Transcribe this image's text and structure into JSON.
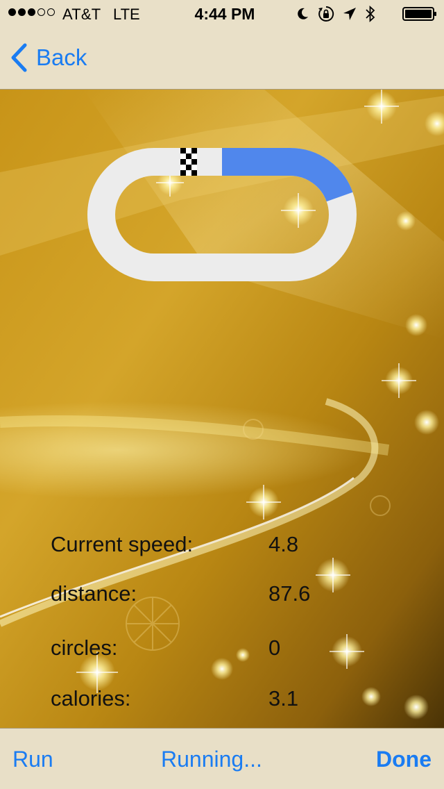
{
  "status_bar": {
    "carrier": "AT&T",
    "network": "LTE",
    "time": "4:44 PM",
    "signal_bars_filled": 3,
    "signal_bars_total": 5,
    "icons": [
      "moon-icon",
      "rotation-lock-icon",
      "location-icon",
      "bluetooth-icon",
      "battery-icon"
    ]
  },
  "nav": {
    "back_label": "Back"
  },
  "track": {
    "progress_fraction": 0.22,
    "start_marker": "checkered-flag",
    "progress_color": "#5087ec",
    "track_color": "#ececec"
  },
  "stats": [
    {
      "label": "Current speed:",
      "value": "4.8"
    },
    {
      "label": "distance:",
      "value": "87.6"
    },
    {
      "label": "circles:",
      "value": "0"
    },
    {
      "label": "calories:",
      "value": "3.1"
    }
  ],
  "toolbar": {
    "run_label": "Run",
    "running_label": "Running...",
    "done_label": "Done"
  },
  "colors": {
    "accent": "#1a7cf2",
    "bar_background": "#e9e0c8"
  }
}
